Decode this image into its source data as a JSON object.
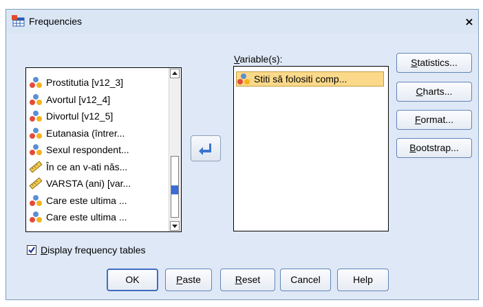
{
  "window": {
    "title": "Frequencies",
    "close_label": "×"
  },
  "source_list": {
    "items": [
      {
        "label": "Prostitutia [v12_3]",
        "icon": "nominal-variable-icon"
      },
      {
        "label": "Avortul [v12_4]",
        "icon": "nominal-variable-icon"
      },
      {
        "label": "Divortul [v12_5]",
        "icon": "nominal-variable-icon"
      },
      {
        "label": "Eutanasia (întrer...",
        "icon": "nominal-variable-icon"
      },
      {
        "label": "Sexul respondent...",
        "icon": "nominal-variable-icon"
      },
      {
        "label": "În ce an v-ati năs...",
        "icon": "scale-variable-icon"
      },
      {
        "label": "VARSTA (ani) [var...",
        "icon": "scale-variable-icon"
      },
      {
        "label": "Care este ultima ...",
        "icon": "nominal-variable-icon"
      },
      {
        "label": "Care este ultima ...",
        "icon": "nominal-variable-icon"
      }
    ]
  },
  "target": {
    "label_prefix": "",
    "label_mnemonic": "V",
    "label_rest": "ariable(s):",
    "items": [
      {
        "label": "Stiti să folositi comp...",
        "icon": "nominal-variable-icon"
      }
    ]
  },
  "side_buttons": [
    {
      "pre": "",
      "mn": "S",
      "post": "tatistics...",
      "name": "statistics-button"
    },
    {
      "pre": "",
      "mn": "C",
      "post": "harts...",
      "name": "charts-button"
    },
    {
      "pre": "",
      "mn": "F",
      "post": "ormat...",
      "name": "format-button"
    },
    {
      "pre": "",
      "mn": "B",
      "post": "ootstrap...",
      "name": "bootstrap-button"
    }
  ],
  "checkbox": {
    "pre": "",
    "mn": "D",
    "post": "isplay frequency tables",
    "checked": true
  },
  "bottom_buttons": {
    "ok": "OK",
    "paste": {
      "pre": "",
      "mn": "P",
      "post": "aste"
    },
    "reset": {
      "pre": "",
      "mn": "R",
      "post": "eset"
    },
    "cancel": "Cancel",
    "help": "Help"
  },
  "colors": {
    "dialog_bg": "#dfe8f6",
    "selected_bg": "#fbd98a",
    "accent": "#3d6cc0"
  }
}
